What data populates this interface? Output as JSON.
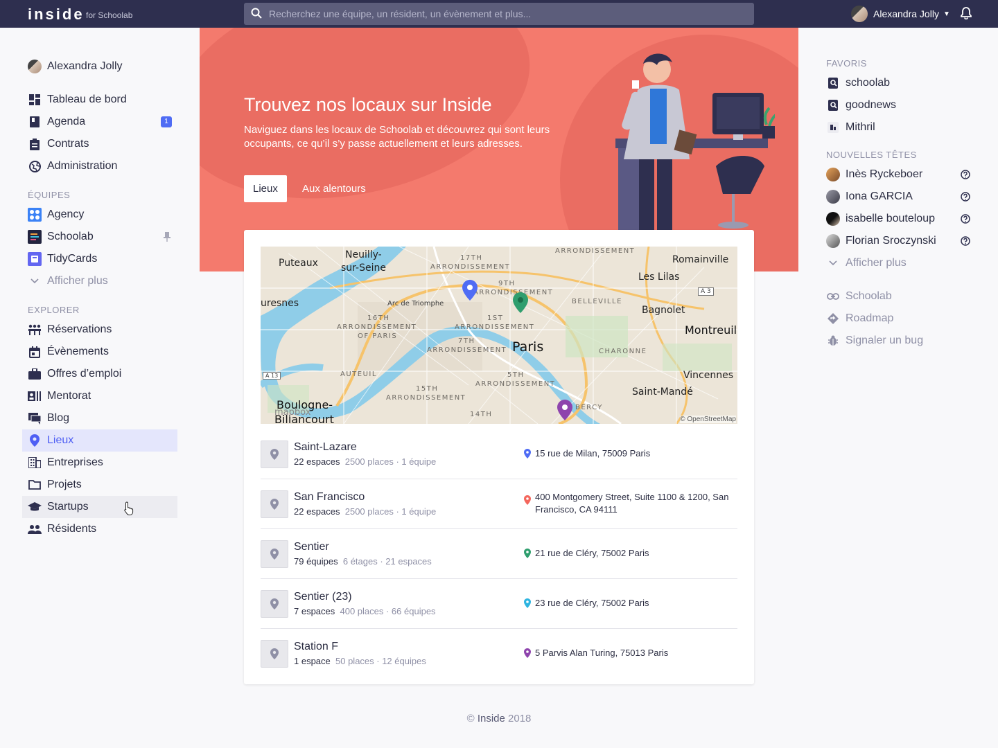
{
  "topbar": {
    "logo": "inside",
    "logo_sub": "for Schoolab",
    "search_placeholder": "Recherchez une équipe, un résident, un évènement et plus...",
    "user_name": "Alexandra Jolly"
  },
  "sidebar": {
    "user": "Alexandra Jolly",
    "main_items": [
      {
        "label": "Tableau de bord",
        "icon": "dashboard-icon"
      },
      {
        "label": "Agenda",
        "icon": "calendar-icon",
        "badge": "1"
      },
      {
        "label": "Contrats",
        "icon": "clipboard-icon"
      },
      {
        "label": "Administration",
        "icon": "globe-icon"
      }
    ],
    "teams_title": "ÉQUIPES",
    "teams": [
      {
        "label": "Agency",
        "icon": "agency-logo-icon"
      },
      {
        "label": "Schoolab",
        "icon": "schoolab-logo-icon",
        "pinned": true
      },
      {
        "label": "TidyCards",
        "icon": "tidycards-logo-icon"
      }
    ],
    "teams_more": "Afficher plus",
    "explore_title": "EXPLORER",
    "explore": [
      {
        "label": "Réservations",
        "icon": "booking-icon"
      },
      {
        "label": "Évènements",
        "icon": "event-icon"
      },
      {
        "label": "Offres d’emploi",
        "icon": "briefcase-icon"
      },
      {
        "label": "Mentorat",
        "icon": "mentor-icon"
      },
      {
        "label": "Blog",
        "icon": "blog-icon"
      },
      {
        "label": "Lieux",
        "icon": "location-icon",
        "active": true
      },
      {
        "label": "Entreprises",
        "icon": "building-icon"
      },
      {
        "label": "Projets",
        "icon": "folder-icon"
      },
      {
        "label": "Startups",
        "icon": "graduation-icon",
        "hover": true
      },
      {
        "label": "Résidents",
        "icon": "people-icon"
      }
    ]
  },
  "hero": {
    "title": "Trouvez nos locaux sur Inside",
    "text": "Naviguez dans les locaux de Schoolab et découvrez qui sont leurs occupants, ce qu’il s’y passe actuellement et leurs adresses.",
    "tabs": [
      "Lieux",
      "Aux alentours"
    ],
    "active_tab": "Lieux",
    "color": "#f47a6d"
  },
  "map": {
    "labels": [
      "Puteaux",
      "Neuilly-",
      "sur-Seine",
      "17TH",
      "ARRONDISSEMENT",
      "ARRONDISSEMENT",
      "Romainville",
      "Les Lilas",
      "uresnes",
      "Arc de Triomphe",
      "9TH",
      "ARRONDISSEMENT",
      "BELLEVILLE",
      "A 3",
      "Bagnolet",
      "16TH",
      "ARRONDISSEMENT",
      "OF PARIS",
      "1ST",
      "ARRONDISSEMENT",
      "Montreuil",
      "7TH",
      "ARRONDISSEMENT",
      "Paris",
      "CHARONNE",
      "A 13",
      "AUTEUIL",
      "5TH",
      "ARRONDISSEMENT",
      "Vincennes",
      "15TH",
      "ARRONDISSEMENT",
      "Saint-Mandé",
      "Boulogne-",
      "Billancourt",
      "mapbox",
      "BERCY",
      "14TH",
      "© OpenStreetMap"
    ]
  },
  "places": [
    {
      "name": "Saint-Lazare",
      "count": "22 espaces",
      "details": "2500 places · 1 équipe",
      "address": "15 rue de Milan, 75009 Paris",
      "color": "#4f6cf4"
    },
    {
      "name": "San Francisco",
      "count": "22 espaces",
      "details": "2500 places · 1 équipe",
      "address": "400 Montgomery Street, Suite 1100 & 1200, San Francisco, CA 94111",
      "color": "#f4665c"
    },
    {
      "name": "Sentier",
      "count": "79 équipes",
      "details": "6 étages · 21 espaces",
      "address": "21 rue de Cléry, 75002 Paris",
      "color": "#2f9e6e"
    },
    {
      "name": "Sentier (23)",
      "count": "7 espaces",
      "details": "400 places · 66 équipes",
      "address": "23 rue de Cléry, 75002 Paris",
      "color": "#2eb4e0"
    },
    {
      "name": "Station F",
      "count": "1 espace",
      "details": "50 places · 12 équipes",
      "address": "5 Parvis Alan Turing, 75013 Paris",
      "color": "#8e44ad"
    }
  ],
  "right": {
    "fav_title": "FAVORIS",
    "favorites": [
      "schoolab",
      "goodnews",
      "Mithril"
    ],
    "new_title": "NOUVELLES TÊTES",
    "new_people": [
      "Inès Ryckeboer",
      "Iona GARCIA",
      "isabelle bouteloup",
      "Florian Sroczynski"
    ],
    "more": "Afficher plus",
    "links": [
      "Schoolab",
      "Roadmap",
      "Signaler un bug"
    ]
  },
  "footer": {
    "copy": "©",
    "brand": "Inside",
    "year": "2018"
  },
  "colors": {
    "accent": "#4f5ff4",
    "topbar": "#2e2f4f",
    "hero": "#f47a6d"
  }
}
